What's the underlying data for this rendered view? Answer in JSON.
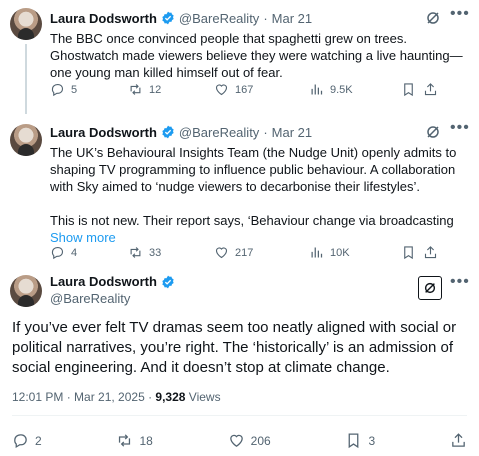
{
  "tweets": [
    {
      "name": "Laura Dodsworth",
      "handle": "@BareReality",
      "separator": "·",
      "date": "Mar 21",
      "text": "The BBC once convinced people that spaghetti grew on trees. Ghostwatch made viewers believe they were watching a live haunting—one young man killed himself out of fear.",
      "show_more": "",
      "replies": "5",
      "reposts": "12",
      "likes": "167",
      "views": "9.5K"
    },
    {
      "name": "Laura Dodsworth",
      "handle": "@BareReality",
      "separator": "·",
      "date": "Mar 21",
      "text": "The UK’s Behavioural Insights Team (the Nudge Unit) openly admits to shaping TV programming to influence public behaviour. A collaboration with Sky aimed to ‘nudge viewers to decarbonise their lifestyles’.",
      "text2": "This is not new. Their report says, ‘Behaviour change via broadcasting",
      "show_more": "Show more",
      "replies": "4",
      "reposts": "33",
      "likes": "217",
      "views": "10K"
    }
  ],
  "main": {
    "name": "Laura Dodsworth",
    "handle": "@BareReality",
    "text": "If you’ve ever felt TV dramas seem too neatly aligned with social or political narratives, you’re right. The ‘historically’ is an admission of social engineering. And it doesn’t stop at climate change.",
    "time": "12:01 PM · Mar 21, 2025 ·",
    "views_count": "9,328",
    "views_label": "Views",
    "replies": "2",
    "reposts": "18",
    "likes": "206",
    "bookmarks": "3"
  },
  "more_glyph": "•••",
  "colors": {
    "text": "#0f1419",
    "muted": "#536471",
    "link": "#1d9bf0",
    "verified": "#1d9bf0"
  },
  "icons": [
    "verified-badge-icon",
    "grok-icon",
    "more-icon",
    "reply-icon",
    "repost-icon",
    "like-icon",
    "views-icon",
    "bookmark-icon",
    "share-icon"
  ]
}
